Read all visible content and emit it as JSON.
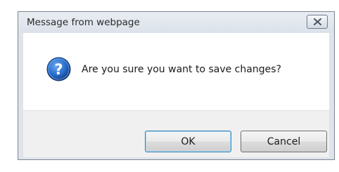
{
  "dialog": {
    "title": "Message from webpage",
    "message": "Are you sure you want to save changes?",
    "icon": "question-icon",
    "close_icon": "close-icon",
    "buttons": {
      "ok_label": "OK",
      "cancel_label": "Cancel"
    },
    "colors": {
      "frame": "#dfe3ea",
      "button_area": "#f0f0f0",
      "icon_blue": "#1f5fb4"
    }
  }
}
